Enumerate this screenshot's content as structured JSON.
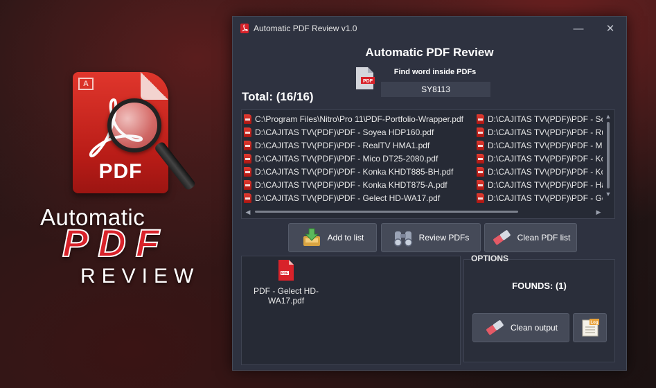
{
  "promo": {
    "doc_label": "PDF",
    "badge": "A",
    "line1": "Automatic",
    "line2": "PDF",
    "line3": "REVIEW"
  },
  "window": {
    "title": "Automatic PDF Review v1.0",
    "minimize_glyph": "—",
    "close_glyph": "✕"
  },
  "header": {
    "app_title": "Automatic PDF Review",
    "find_label": "Find word inside PDFs",
    "search_value": "SY8113",
    "total": "Total: (16/16)"
  },
  "file_list": {
    "column1": [
      "C:\\Program Files\\Nitro\\Pro 11\\PDF-Portfolio-Wrapper.pdf",
      "D:\\CAJITAS TV\\(PDF)\\PDF - Soyea HDP160.pdf",
      "D:\\CAJITAS TV\\(PDF)\\PDF - RealTV HMA1.pdf",
      "D:\\CAJITAS TV\\(PDF)\\PDF - Mico DT25-2080.pdf",
      "D:\\CAJITAS TV\\(PDF)\\PDF - Konka KHDT885-BH.pdf",
      "D:\\CAJITAS TV\\(PDF)\\PDF - Konka KHDT875-A.pdf",
      "D:\\CAJITAS TV\\(PDF)\\PDF - Gelect HD-WA17.pdf"
    ],
    "column2": [
      "D:\\CAJITAS TV\\(PDF)\\PDF - Soy",
      "D:\\CAJITAS TV\\(PDF)\\PDF - Run",
      "D:\\CAJITAS TV\\(PDF)\\PDF - Mic",
      "D:\\CAJITAS TV\\(PDF)\\PDF - Kor",
      "D:\\CAJITAS TV\\(PDF)\\PDF - Kor",
      "D:\\CAJITAS TV\\(PDF)\\PDF - Hai",
      "D:\\CAJITAS TV\\(PDF)\\PDF - Gel"
    ]
  },
  "buttons": {
    "add": "Add to list",
    "review": "Review PDFs",
    "clean_list": "Clean PDF list",
    "clean_output": "Clean output",
    "log_badge": "Log"
  },
  "results": {
    "items": [
      "PDF - Gelect HD-WA17.pdf"
    ]
  },
  "options": {
    "label": "OPTIONS",
    "founds": "FOUNDS: (1)"
  },
  "colors": {
    "window_bg": "#2e3240",
    "panel_bg": "#262a35",
    "button_bg": "#454a58",
    "pdf_red": "#d8222a"
  }
}
